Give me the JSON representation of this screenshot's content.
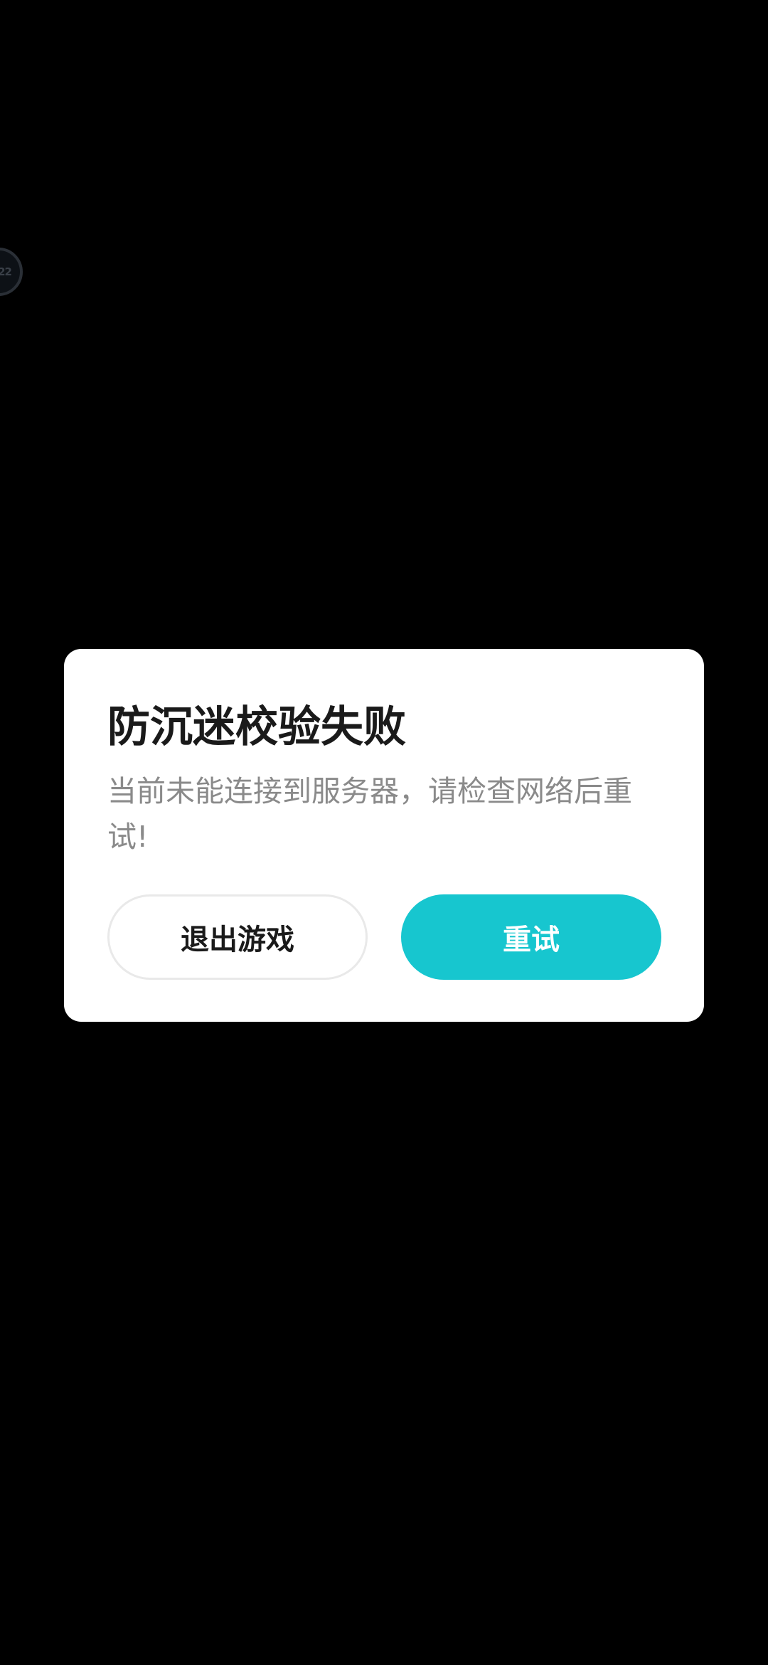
{
  "floating_ball": {
    "glyph": "22"
  },
  "dialog": {
    "title": "防沉迷校验失败",
    "message": "当前未能连接到服务器，请检查网络后重试!",
    "exit_button_label": "退出游戏",
    "retry_button_label": "重试"
  },
  "colors": {
    "background": "#000000",
    "dialog_background": "#ffffff",
    "title_text": "#1a1a1a",
    "message_text": "#8a8a8a",
    "accent": "#17c6cf",
    "exit_button_border": "#e9e9e9"
  }
}
